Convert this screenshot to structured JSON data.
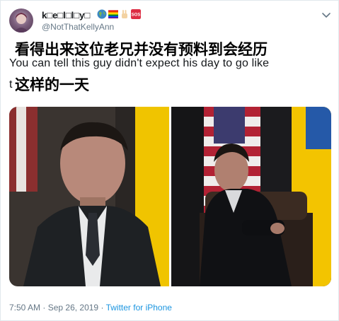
{
  "author": {
    "display_name": "k□e□l□l□y□",
    "handle": "@NotThatKellyAnn",
    "name_emojis": [
      "globe-emoji",
      "rainbow-flag-emoji",
      "peace-hand-emoji",
      "sos-emoji"
    ]
  },
  "tweet": {
    "text_line1": "You can tell this guy didn't expect his day to go like",
    "text_line2_start": "t"
  },
  "caption": {
    "line1": "看得出来这位老兄并没有预料到会经历",
    "line2": "这样的一天"
  },
  "meta": {
    "time": "7:50 AM",
    "separator": " · ",
    "date": "Sep 26, 2019",
    "source": "Twitter for iPhone"
  },
  "colors": {
    "link": "#1b95e0",
    "secondary_text": "#657786",
    "flag_yellow": "#ffd500",
    "flag_blue": "#005bbb",
    "us_red": "#b22234"
  }
}
